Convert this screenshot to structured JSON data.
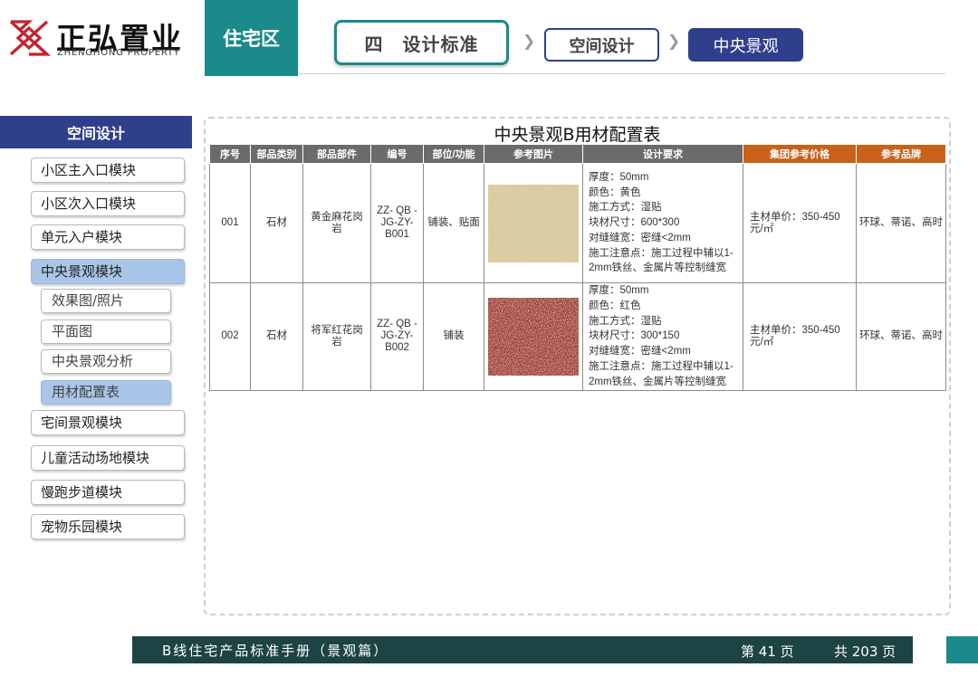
{
  "brand": {
    "name_cn": "正弘置业",
    "name_en": "ZHENGHONG PROPERTY"
  },
  "header": {
    "zone": "住宅区",
    "breadcrumb": [
      "四　设计标准",
      "空间设计",
      "中央景观"
    ]
  },
  "sidebar": {
    "title": "空间设计",
    "items": [
      "小区主入口模块",
      "小区次入口模块",
      "单元入户模块",
      "中央景观模块"
    ],
    "sub_items": [
      "效果图/照片",
      "平面图",
      "中央景观分析",
      "用材配置表"
    ],
    "items_after": [
      "宅间景观模块",
      "儿童活动场地模块",
      "慢跑步道模块",
      "宠物乐园模块"
    ],
    "active_item": "中央景观模块",
    "active_sub_item": "用材配置表"
  },
  "main": {
    "table_title": "中央景观B用材配置表",
    "columns": [
      "序号",
      "部品类别",
      "部品部件",
      "编号",
      "部位/功能",
      "参考图片",
      "设计要求",
      "集团参考价格",
      "参考品牌"
    ],
    "highlight_column_color": "#c9611a",
    "header_color": "#6b6b6b",
    "rows": [
      {
        "no": "001",
        "category": "石材",
        "part": "黄金麻花岗岩",
        "code": "ZZ- QB -JG-ZY-B001",
        "position": "铺装、贴面",
        "image": "yellow-granite-swatch",
        "requirements": [
          "厚度：50mm",
          "颜色：黄色",
          "施工方式：湿贴",
          "块材尺寸：600*300",
          "对缝缝宽：密缝<2mm",
          "施工注意点：施工过程中辅以1-",
          "2mm铁丝、金属片等控制缝宽"
        ],
        "price": "主材单价：350-450元/㎡",
        "brand": "环球、蒂诺、高时"
      },
      {
        "no": "002",
        "category": "石材",
        "part": "将军红花岗岩",
        "code": "ZZ- QB -JG-ZY-B002",
        "position": "铺装",
        "image": "red-granite-swatch",
        "requirements": [
          "厚度：50mm",
          "颜色：红色",
          "施工方式：湿贴",
          "块材尺寸：300*150",
          "对缝缝宽：密缝<2mm",
          "施工注意点：施工过程中辅以1-",
          "2mm铁丝、金属片等控制缝宽"
        ],
        "price": "主材单价：350-450元/㎡",
        "brand": "环球、蒂诺、高时"
      }
    ]
  },
  "footer": {
    "title": "B线住宅产品标准手册（景观篇）",
    "page": "第 41 页",
    "total": "共 203 页"
  },
  "colors": {
    "teal": "#1a8a8a",
    "navy": "#2f3f8c",
    "footer": "#1d4344",
    "brand_red": "#c8202f"
  }
}
